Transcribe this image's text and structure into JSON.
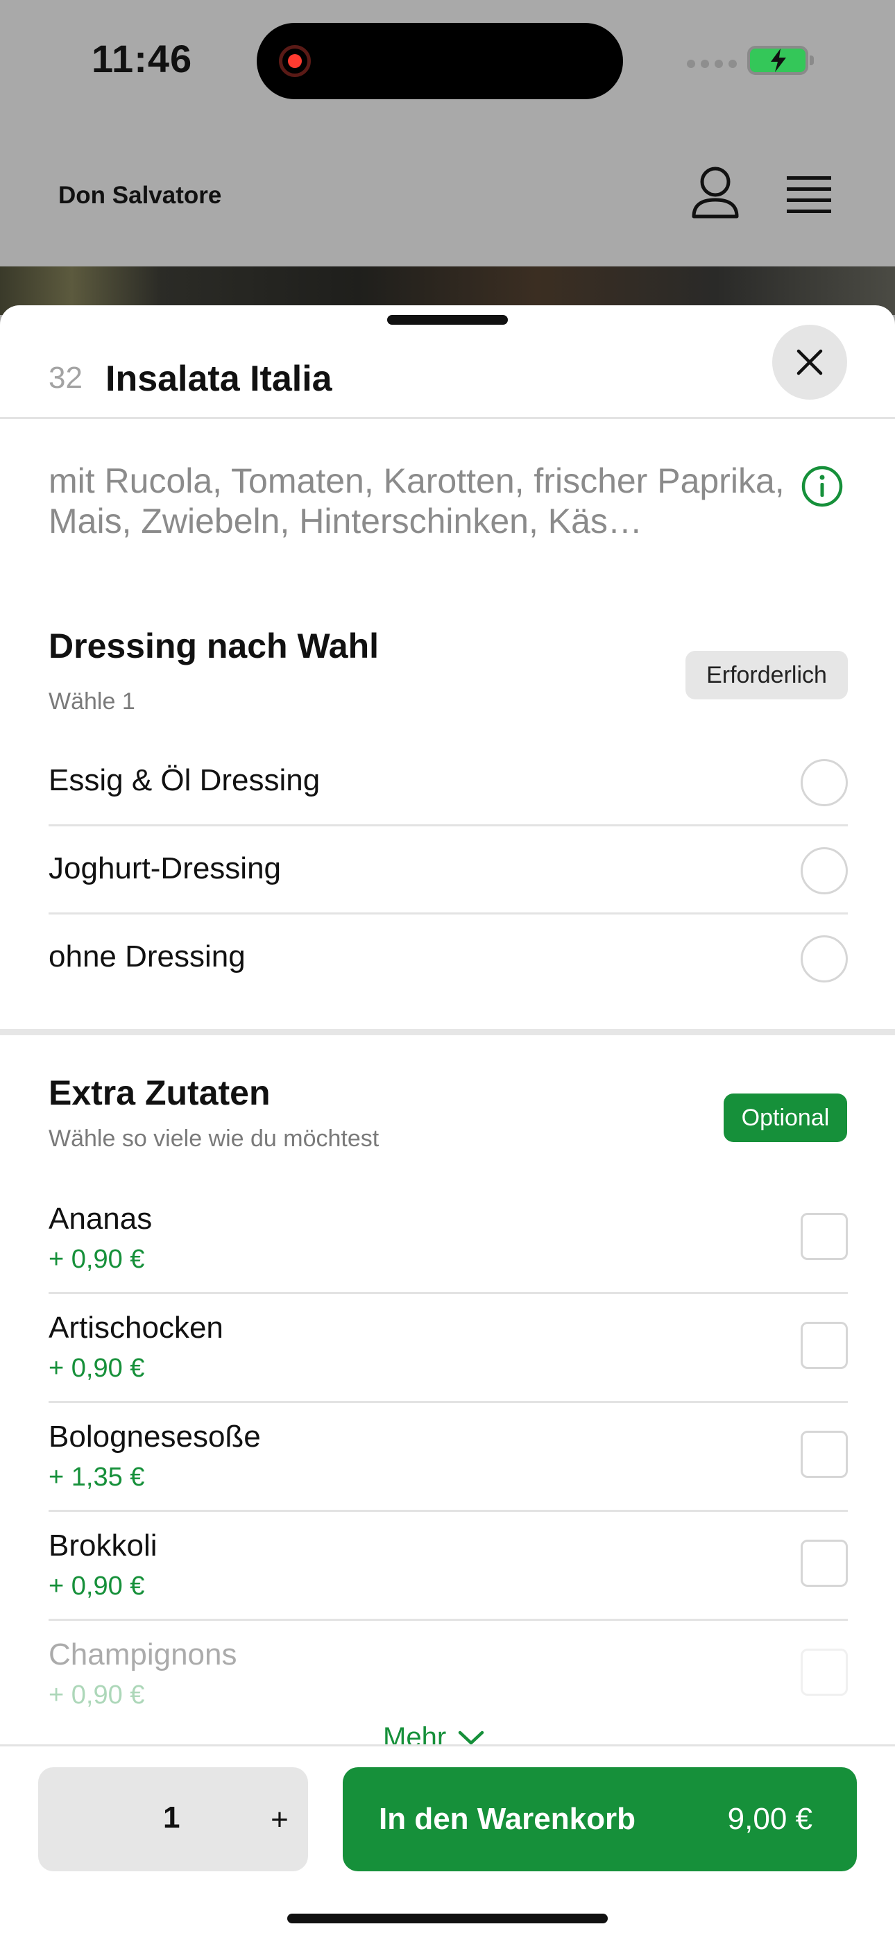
{
  "status_bar": {
    "time": "11:46"
  },
  "background_page": {
    "title": "Don Salvatore"
  },
  "sheet": {
    "item_number": "32",
    "item_name": "Insalata Italia",
    "description": "mit Rucola, Tomaten, Karotten, frischer Paprika, Mais,  Zwiebeln, Hinterschinken, Käs…"
  },
  "dressing": {
    "title": "Dressing nach Wahl",
    "subtitle": "Wähle 1",
    "badge": "Erforderlich",
    "options": [
      {
        "label": "Essig & Öl Dressing"
      },
      {
        "label": "Joghurt-Dressing"
      },
      {
        "label": "ohne Dressing"
      }
    ]
  },
  "extras": {
    "title": "Extra Zutaten",
    "subtitle": "Wähle so viele wie du möchtest",
    "badge": "Optional",
    "items": [
      {
        "label": "Ananas",
        "price": "+ 0,90 €"
      },
      {
        "label": "Artischocken",
        "price": "+ 0,90 €"
      },
      {
        "label": "Bolognesesoße",
        "price": "+ 1,35 €"
      },
      {
        "label": "Brokkoli",
        "price": "+ 0,90 €"
      },
      {
        "label": "Champignons",
        "price": "+ 0,90 €"
      }
    ],
    "more_label": "Mehr"
  },
  "footer": {
    "quantity": "1",
    "plus_label": "+",
    "cart_label": "In den Warenkorb",
    "cart_price": "9,00 €"
  },
  "colors": {
    "accent_green": "#16903a",
    "badge_gray": "#e6e6e6"
  }
}
